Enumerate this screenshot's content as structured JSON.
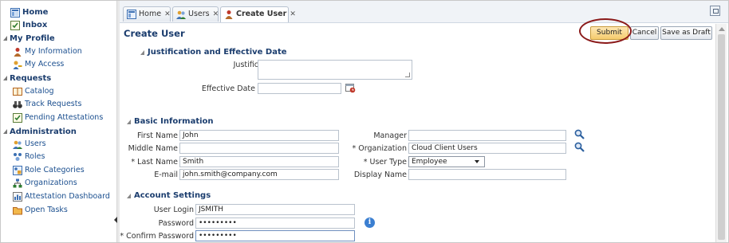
{
  "sidebar": {
    "home": "Home",
    "inbox": "Inbox",
    "sections": [
      {
        "label": "My Profile",
        "items": [
          "My Information",
          "My Access"
        ]
      },
      {
        "label": "Requests",
        "items": [
          "Catalog",
          "Track Requests",
          "Pending Attestations"
        ]
      },
      {
        "label": "Administration",
        "items": [
          "Users",
          "Roles",
          "Role Categories",
          "Organizations",
          "Attestation Dashboard",
          "Open Tasks"
        ]
      }
    ]
  },
  "tabs": [
    {
      "label": "Home",
      "close": "✕"
    },
    {
      "label": "Users",
      "close": "✕"
    },
    {
      "label": "Create User",
      "close": "✕"
    }
  ],
  "page": {
    "title": "Create User",
    "buttons": {
      "submit": "Submit",
      "cancel": "Cancel",
      "save_draft": "Save as Draft"
    }
  },
  "justification": {
    "header": "Justification and Effective Date",
    "justification_label": "Justification",
    "effective_date_label": "Effective Date"
  },
  "basic": {
    "header": "Basic Information",
    "first_name_label": "First Name",
    "first_name": "John",
    "middle_name_label": "Middle Name",
    "middle_name": "",
    "last_name_label": "* Last Name",
    "last_name": "Smith",
    "email_label": "E-mail",
    "email": "john.smith@company.com",
    "manager_label": "Manager",
    "manager": "",
    "organization_label": "* Organization",
    "organization": "Cloud Client Users",
    "user_type_label": "* User Type",
    "user_type": "Employee",
    "display_name_label": "Display Name",
    "display_name": ""
  },
  "account": {
    "header": "Account Settings",
    "user_login_label": "User Login",
    "user_login": "JSMITH",
    "password_label": "Password",
    "password": "•••••••••",
    "confirm_label": "* Confirm Password",
    "confirm": "•••••••••"
  },
  "colors": {
    "accent": "#1b3d6e",
    "submit_bg": "#f5cc6e",
    "highlight_ring": "#8b1a1a"
  }
}
